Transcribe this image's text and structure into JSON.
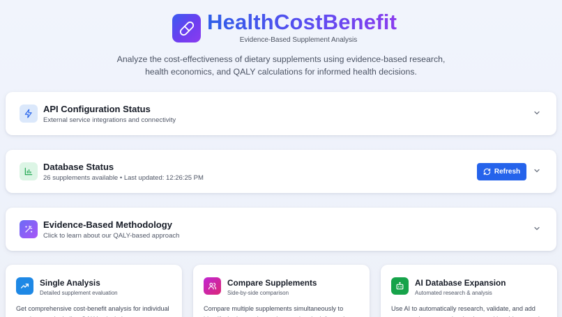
{
  "brand": {
    "name": "HealthCostBenefit",
    "tagline": "Evidence-Based Supplement Analysis",
    "intro": "Analyze the cost-effectiveness of dietary supplements using evidence-based research, health economics, and QALY calculations for informed health decisions."
  },
  "sections": {
    "api": {
      "title": "API Configuration Status",
      "subtitle": "External service integrations and connectivity",
      "icon": "lightning-icon"
    },
    "database": {
      "title": "Database Status",
      "subtitle": "26 supplements available • Last updated: 12:26:25 PM",
      "refresh_label": "Refresh",
      "icon": "bar-chart-icon"
    },
    "methodology": {
      "title": "Evidence-Based Methodology",
      "subtitle": "Click to learn about our QALY-based approach",
      "icon": "sparkles-icon"
    }
  },
  "features": [
    {
      "title": "Single Analysis",
      "subtitle": "Detailed supplement evaluation",
      "description": "Get comprehensive cost-benefit analysis for individual supplements including QALY calculations",
      "icon": "trending-up-icon",
      "color": "#1e88e5"
    },
    {
      "title": "Compare Supplements",
      "subtitle": "Side-by-side comparison",
      "description": "Compare multiple supplements simultaneously to identify the best value options and make informed",
      "icon": "users-icon",
      "color": "#c026d3"
    },
    {
      "title": "AI Database Expansion",
      "subtitle": "Automated research & analysis",
      "description": "Use AI to automatically research, validate, and add new supplements to the database with evidence review",
      "icon": "robot-icon",
      "color": "#16a34a"
    }
  ],
  "colors": {
    "accent_blue": "#2563eb",
    "brand_gradient_start": "#2f5fe8",
    "brand_gradient_end": "#8a3cee"
  }
}
